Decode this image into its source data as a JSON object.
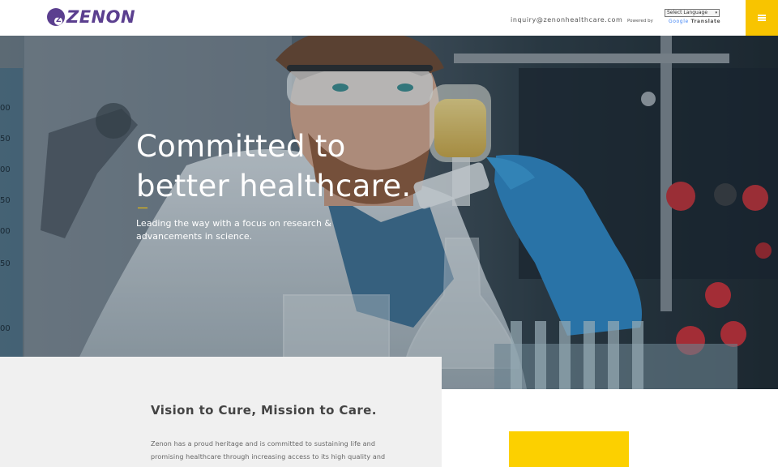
{
  "header": {
    "logo_mark": "Z",
    "logo_text": "ZENON",
    "email": "inquiry@zenonhealthcare.com",
    "powered_by": "Powered by",
    "language_select": {
      "selected": "Select Language"
    },
    "google_translate": {
      "brand": "Google",
      "label": "Translate"
    },
    "menu_icon": "hamburger-icon"
  },
  "hero": {
    "title_line1": "Committed to",
    "title_line2": "better healthcare.",
    "subtitle": "Leading the way with a focus on research & advancements in science.",
    "ruler_labels": [
      "00",
      "50",
      "00",
      "50",
      "00",
      "50",
      "00"
    ]
  },
  "vision": {
    "title": "Vision to Cure, Mission to Care.",
    "body_line1": "Zenon has a proud heritage and is committed to sustaining life and",
    "body_line2": "promising healthcare through increasing access to its high quality and"
  },
  "colors": {
    "brand_purple": "#5b3f8f",
    "accent_yellow": "#f8c400",
    "panel_grey": "#f0f0f0"
  }
}
